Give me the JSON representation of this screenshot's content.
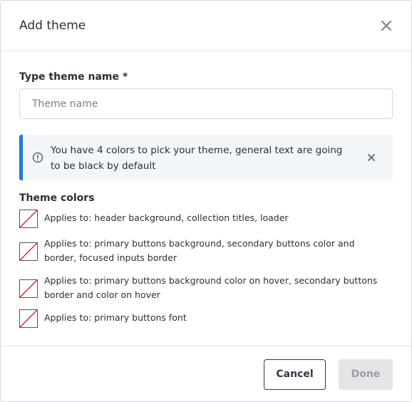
{
  "dialog": {
    "title": "Add theme",
    "close_icon": "close-icon"
  },
  "form": {
    "name_label": "Type theme name *",
    "name_placeholder": "Theme name",
    "name_value": ""
  },
  "info": {
    "icon": "info-circle-icon",
    "text": "You have 4 colors to pick your theme, general text are going to be black by default",
    "close_icon": "close-icon",
    "accent_color": "#1f7ad6"
  },
  "theme_colors": {
    "label": "Theme colors",
    "items": [
      {
        "text": "Applies to: header background, collection titles, loader",
        "value": "none"
      },
      {
        "text": "Applies to: primary buttons background, secondary buttons color and border, focused inputs border",
        "value": "none"
      },
      {
        "text": "Applies to: primary buttons background color on hover, secondary buttons border and color on hover",
        "value": "none"
      },
      {
        "text": "Applies to: primary buttons font",
        "value": "none"
      }
    ]
  },
  "footer": {
    "cancel_label": "Cancel",
    "done_label": "Done"
  }
}
